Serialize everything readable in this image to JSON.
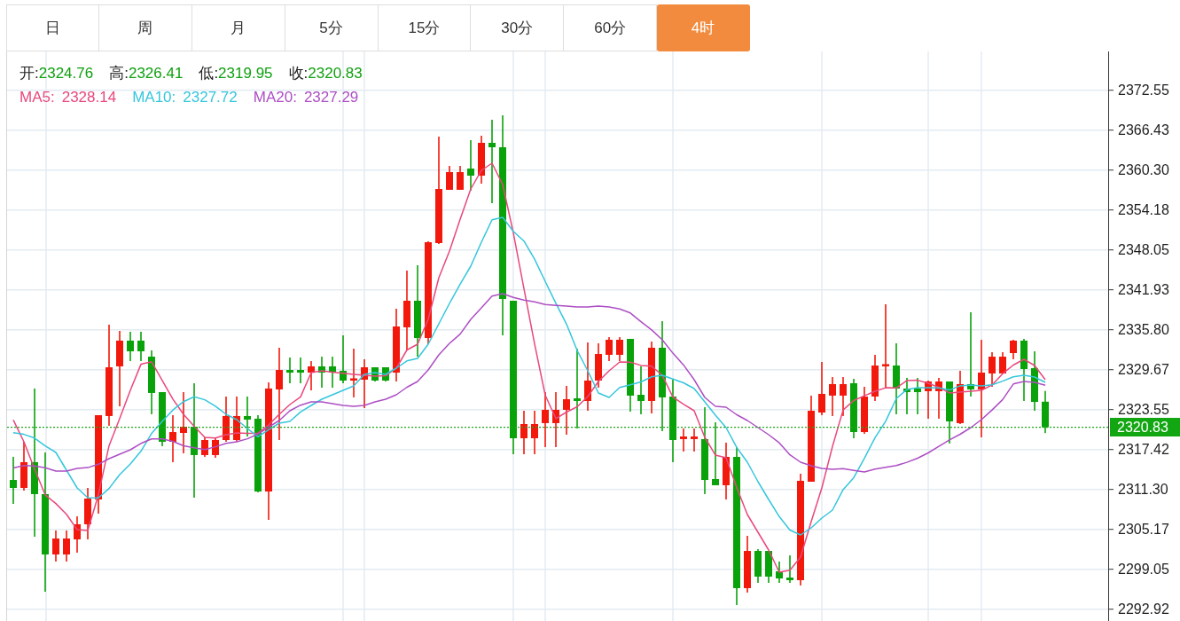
{
  "tabs": [
    {
      "label": "日",
      "selected": false
    },
    {
      "label": "周",
      "selected": false
    },
    {
      "label": "月",
      "selected": false
    },
    {
      "label": "5分",
      "selected": false
    },
    {
      "label": "15分",
      "selected": false
    },
    {
      "label": "30分",
      "selected": false
    },
    {
      "label": "60分",
      "selected": false
    },
    {
      "label": "4时",
      "selected": true
    }
  ],
  "legend": {
    "ohlc": [
      {
        "label": "开:",
        "value": "2324.76"
      },
      {
        "label": "高:",
        "value": "2326.41"
      },
      {
        "label": "低:",
        "value": "2319.95"
      },
      {
        "label": "收:",
        "value": "2320.83"
      }
    ],
    "moving_average_values": [
      "2328.14",
      "2327.72",
      "2327.29"
    ]
  },
  "chart": {
    "chart_data": {
      "type": "candlestick",
      "grid": true,
      "ohlc": [
        [
          2312.75,
          2316.29,
          2309.08,
          2311.53
        ],
        [
          2311.53,
          2318.61,
          2311.12,
          2315.48
        ],
        [
          2315.48,
          2326.78,
          2304.04,
          2310.58
        ],
        [
          2310.58,
          2316.97,
          2295.6,
          2301.32
        ],
        [
          2301.32,
          2305.0,
          2300.23,
          2303.77
        ],
        [
          2301.32,
          2305.0,
          2300.23,
          2303.77
        ],
        [
          2303.63,
          2307.17,
          2301.59,
          2305.95
        ],
        [
          2305.95,
          2311.53,
          2303.63,
          2309.9
        ],
        [
          2309.76,
          2322.69,
          2307.58,
          2322.69
        ],
        [
          2322.56,
          2336.58,
          2321.06,
          2330.04
        ],
        [
          2330.18,
          2335.62,
          2324.05,
          2334.13
        ],
        [
          2334.13,
          2335.49,
          2330.99,
          2332.49
        ],
        [
          2334.13,
          2335.49,
          2330.99,
          2332.49
        ],
        [
          2331.67,
          2332.63,
          2322.83,
          2326.1
        ],
        [
          2326.23,
          2326.23,
          2317.93,
          2318.61
        ],
        [
          2318.61,
          2322.69,
          2315.48,
          2320.1
        ],
        [
          2319.97,
          2326.23,
          2316.84,
          2320.92
        ],
        [
          2320.92,
          2327.59,
          2310.03,
          2316.57
        ],
        [
          2316.57,
          2319.29,
          2316.29,
          2318.88
        ],
        [
          2316.57,
          2319.29,
          2316.16,
          2318.88
        ],
        [
          2318.88,
          2325.55,
          2318.61,
          2322.56
        ],
        [
          2318.88,
          2325.55,
          2318.61,
          2322.56
        ],
        [
          2322.56,
          2325.55,
          2319.42,
          2322.01
        ],
        [
          2322.15,
          2322.69,
          2310.85,
          2310.98
        ],
        [
          2310.98,
          2327.73,
          2306.63,
          2326.78
        ],
        [
          2326.64,
          2333.04,
          2318.88,
          2329.63
        ],
        [
          2329.63,
          2331.54,
          2327.59,
          2329.22
        ],
        [
          2329.63,
          2331.54,
          2327.59,
          2329.22
        ],
        [
          2329.22,
          2330.99,
          2326.5,
          2330.18
        ],
        [
          2330.18,
          2331.67,
          2326.91,
          2329.22
        ],
        [
          2330.18,
          2331.67,
          2326.91,
          2329.22
        ],
        [
          2329.5,
          2334.94,
          2327.59,
          2328.0
        ],
        [
          2328.0,
          2332.9,
          2325.42,
          2328.27
        ],
        [
          2328.14,
          2331.27,
          2323.78,
          2330.04
        ],
        [
          2330.04,
          2330.04,
          2327.86,
          2328.0
        ],
        [
          2330.04,
          2330.04,
          2327.86,
          2328.0
        ],
        [
          2329.22,
          2339.03,
          2327.86,
          2336.3
        ],
        [
          2336.17,
          2344.88,
          2332.63,
          2340.25
        ],
        [
          2340.25,
          2345.7,
          2331.67,
          2334.53
        ],
        [
          2334.53,
          2349.37,
          2333.58,
          2349.23
        ],
        [
          2349.1,
          2365.43,
          2348.96,
          2357.4
        ],
        [
          2357.27,
          2360.94,
          2357.27,
          2359.99
        ],
        [
          2357.27,
          2360.94,
          2357.27,
          2359.99
        ],
        [
          2360.53,
          2364.89,
          2357.13,
          2359.44
        ],
        [
          2359.44,
          2365.57,
          2358.22,
          2364.48
        ],
        [
          2364.48,
          2368.02,
          2355.22,
          2363.8
        ],
        [
          2363.8,
          2368.7,
          2334.94,
          2340.52
        ],
        [
          2340.25,
          2340.25,
          2316.7,
          2319.15
        ],
        [
          2319.15,
          2323.37,
          2316.7,
          2321.33
        ],
        [
          2319.15,
          2323.37,
          2316.7,
          2321.33
        ],
        [
          2321.47,
          2326.23,
          2317.79,
          2323.51
        ],
        [
          2321.47,
          2326.23,
          2317.79,
          2323.51
        ],
        [
          2323.51,
          2327.18,
          2319.7,
          2325.14
        ],
        [
          2325.28,
          2332.9,
          2320.65,
          2324.87
        ],
        [
          2324.87,
          2333.85,
          2323.37,
          2328.0
        ],
        [
          2328.0,
          2333.72,
          2326.91,
          2332.08
        ],
        [
          2331.95,
          2334.67,
          2330.99,
          2334.26
        ],
        [
          2331.95,
          2334.67,
          2330.99,
          2334.26
        ],
        [
          2334.4,
          2334.4,
          2323.24,
          2325.69
        ],
        [
          2325.82,
          2330.18,
          2322.83,
          2324.87
        ],
        [
          2324.87,
          2333.99,
          2322.96,
          2333.04
        ],
        [
          2333.04,
          2337.12,
          2320.24,
          2325.42
        ],
        [
          2325.55,
          2328.14,
          2315.48,
          2318.88
        ],
        [
          2319.02,
          2320.65,
          2317.11,
          2319.42
        ],
        [
          2319.02,
          2320.65,
          2317.11,
          2319.42
        ],
        [
          2319.02,
          2323.91,
          2310.58,
          2312.75
        ],
        [
          2312.89,
          2321.6,
          2311.94,
          2311.94
        ],
        [
          2311.94,
          2318.47,
          2309.76,
          2316.29
        ],
        [
          2316.29,
          2317.79,
          2293.56,
          2296.15
        ],
        [
          2296.15,
          2304.18,
          2295.47,
          2301.86
        ],
        [
          2301.86,
          2302.14,
          2296.96,
          2297.92
        ],
        [
          2301.86,
          2301.86,
          2296.96,
          2297.92
        ],
        [
          2298.73,
          2300.23,
          2296.96,
          2297.64
        ],
        [
          2297.78,
          2301.18,
          2296.96,
          2297.37
        ],
        [
          2297.37,
          2313.71,
          2296.56,
          2312.62
        ],
        [
          2312.48,
          2325.69,
          2312.48,
          2323.37
        ],
        [
          2323.1,
          2330.86,
          2322.69,
          2325.96
        ],
        [
          2325.69,
          2328.54,
          2322.56,
          2327.46
        ],
        [
          2325.69,
          2328.54,
          2322.56,
          2327.46
        ],
        [
          2327.59,
          2328.27,
          2319.15,
          2320.1
        ],
        [
          2320.1,
          2327.05,
          2319.83,
          2325.55
        ],
        [
          2325.55,
          2331.95,
          2324.87,
          2330.31
        ],
        [
          2330.18,
          2339.71,
          2326.78,
          2330.45
        ],
        [
          2330.31,
          2333.72,
          2322.83,
          2326.78
        ],
        [
          2326.78,
          2328.41,
          2322.83,
          2326.23
        ],
        [
          2326.78,
          2328.41,
          2322.83,
          2326.23
        ],
        [
          2326.37,
          2328.0,
          2322.15,
          2327.86
        ],
        [
          2326.37,
          2328.41,
          2322.15,
          2327.86
        ],
        [
          2327.86,
          2327.86,
          2318.34,
          2321.74
        ],
        [
          2321.47,
          2329.5,
          2321.33,
          2327.46
        ],
        [
          2327.46,
          2338.48,
          2325.55,
          2326.64
        ],
        [
          2326.64,
          2334.26,
          2319.29,
          2329.22
        ],
        [
          2329.09,
          2332.36,
          2327.05,
          2331.67
        ],
        [
          2329.09,
          2332.36,
          2329.09,
          2331.67
        ],
        [
          2332.22,
          2334.26,
          2331.27,
          2334.13
        ],
        [
          2334.13,
          2334.4,
          2324.87,
          2329.77
        ],
        [
          2329.9,
          2332.49,
          2323.37,
          2324.73
        ],
        [
          2324.76,
          2326.41,
          2319.95,
          2320.83
        ]
      ],
      "ylim": [
        2291.11,
        2378.5
      ],
      "yticks": [
        {
          "value": 2372.55,
          "label": "2372.55"
        },
        {
          "value": 2366.43,
          "label": "2366.43"
        },
        {
          "value": 2360.3,
          "label": "2360.30"
        },
        {
          "value": 2354.18,
          "label": "2354.18"
        },
        {
          "value": 2348.05,
          "label": "2348.05"
        },
        {
          "value": 2341.93,
          "label": "2341.93"
        },
        {
          "value": 2335.8,
          "label": "2335.80"
        },
        {
          "value": 2329.67,
          "label": "2329.67"
        },
        {
          "value": 2323.55,
          "label": "2323.55"
        },
        {
          "value": 2317.42,
          "label": "2317.42"
        },
        {
          "value": 2311.3,
          "label": "2311.30"
        },
        {
          "value": 2305.17,
          "label": "2305.17"
        },
        {
          "value": 2299.05,
          "label": "2299.05"
        },
        {
          "value": 2292.92,
          "label": "2292.92"
        }
      ],
      "ref_lines": [
        {
          "axis": "y",
          "value": 2320.83,
          "label": "2320.83"
        }
      ],
      "series": [
        {
          "name": "MA5:",
          "type": "line",
          "color": "#e9487c",
          "values": [
            2321.95,
            2318.61,
            2314.41,
            2310.47,
            2309.13,
            2307.48,
            2305.13,
            2304.99,
            2310.48,
            2318.01,
            2322.19,
            2326.5,
            2330.5,
            2330.88,
            2328.03,
            2325.15,
            2322.83,
            2320.97,
            2319.27,
            2319.19,
            2319.7,
            2319.97,
            2319.9,
            2319.93,
            2321.19,
            2322.83,
            2324.32,
            2325.49,
            2329.22,
            2329.5,
            2329.3,
            2329.13,
            2328.95,
            2328.8,
            2328.67,
            2328.73,
            2329.9,
            2332.69,
            2333.58,
            2337.39,
            2343.79,
            2347.87,
            2352.75,
            2357.4,
            2360.26,
            2361.35,
            2358.08,
            2350.69,
            2342.11,
            2333.62,
            2325.75,
            2322.17,
            2323.17,
            2323.98,
            2325.55,
            2327.86,
            2329.5,
            2330.86,
            2330.82,
            2330.33,
            2330.22,
            2328.82,
            2325.45,
            2324.38,
            2323.37,
            2319.29,
            2316.56,
            2316.16,
            2311.6,
            2307.44,
            2304.72,
            2302.0,
            2298.6,
            2298.9,
            2300.91,
            2306.36,
            2311.53,
            2317.88,
            2323.49,
            2324.94,
            2325.67,
            2326.36,
            2326.9,
            2326.87,
            2328.01,
            2328.05,
            2327.59,
            2326.96,
            2326.11,
            2326.24,
            2326.36,
            2326.5,
            2327.33,
            2329.06,
            2330.38,
            2331.26,
            2330.31,
            2328.14
          ]
        },
        {
          "name": "MA10:",
          "type": "line",
          "color": "#35c6dc",
          "values": [
            2320.01,
            2319.75,
            2319.18,
            2317.98,
            2316.97,
            2314.25,
            2311.53,
            2310.03,
            2310.0,
            2311.45,
            2313.57,
            2315.2,
            2317.16,
            2319.89,
            2321.74,
            2323.48,
            2324.77,
            2325.51,
            2325.06,
            2324.08,
            2322.83,
            2322.01,
            2320.65,
            2319.38,
            2320.46,
            2321.46,
            2321.74,
            2323.18,
            2324.19,
            2325.14,
            2325.82,
            2326.5,
            2327.18,
            2328.95,
            2329.22,
            2328.95,
            2329.9,
            2331.02,
            2331.4,
            2333.58,
            2336.71,
            2339.84,
            2342.79,
            2345.56,
            2349.23,
            2352.66,
            2353.04,
            2350.89,
            2349.41,
            2346.63,
            2343.22,
            2339.87,
            2336.67,
            2332.63,
            2329.5,
            2326.09,
            2325.41,
            2326.95,
            2327.35,
            2327.79,
            2328.58,
            2328.82,
            2328.23,
            2327.66,
            2326.77,
            2324.73,
            2322.69,
            2320.78,
            2317.73,
            2315.48,
            2312.48,
            2309.76,
            2307.13,
            2305.06,
            2304.31,
            2305.4,
            2306.9,
            2308.12,
            2311.27,
            2313.11,
            2316.07,
            2319.23,
            2321.75,
            2325.25,
            2326.64,
            2326.91,
            2326.91,
            2326.88,
            2326.56,
            2327.19,
            2327.32,
            2327.18,
            2327.36,
            2327.92,
            2328.57,
            2328.82,
            2328.54,
            2327.72
          ]
        },
        {
          "name": "MA20:",
          "type": "line",
          "color": "#ad4fc4",
          "values": [
            2314.58,
            2314.97,
            2314.9,
            2314.62,
            2314.11,
            2314.11,
            2314.52,
            2314.64,
            2315.16,
            2316.02,
            2316.7,
            2317.38,
            2318.36,
            2319.05,
            2319.04,
            2318.67,
            2317.99,
            2317.68,
            2317.41,
            2317.84,
            2318.37,
            2318.61,
            2319.07,
            2319.79,
            2320.87,
            2321.87,
            2323.37,
            2324.23,
            2324.73,
            2324.73,
            2324.46,
            2324.19,
            2324.05,
            2324.19,
            2324.73,
            2325.14,
            2325.82,
            2326.98,
            2327.86,
            2329.63,
            2331.95,
            2333.72,
            2335.13,
            2337.39,
            2339.16,
            2340.96,
            2341.34,
            2340.75,
            2340.36,
            2340.07,
            2339.68,
            2339.54,
            2339.42,
            2339.3,
            2339.3,
            2339.43,
            2339.3,
            2338.98,
            2338.37,
            2337.02,
            2335.77,
            2334.26,
            2332.2,
            2330.39,
            2328.13,
            2325.41,
            2324.05,
            2323.91,
            2322.76,
            2321.87,
            2320.78,
            2319.7,
            2318.44,
            2316.6,
            2315.48,
            2314.93,
            2314.52,
            2314.4,
            2314.49,
            2314.22,
            2313.98,
            2314.41,
            2314.7,
            2314.97,
            2315.46,
            2316.09,
            2316.9,
            2317.9,
            2318.89,
            2319.76,
            2320.78,
            2322.01,
            2323.49,
            2325.08,
            2327.48,
            2327.86,
            2327.73,
            2327.29
          ]
        }
      ]
    }
  }
}
